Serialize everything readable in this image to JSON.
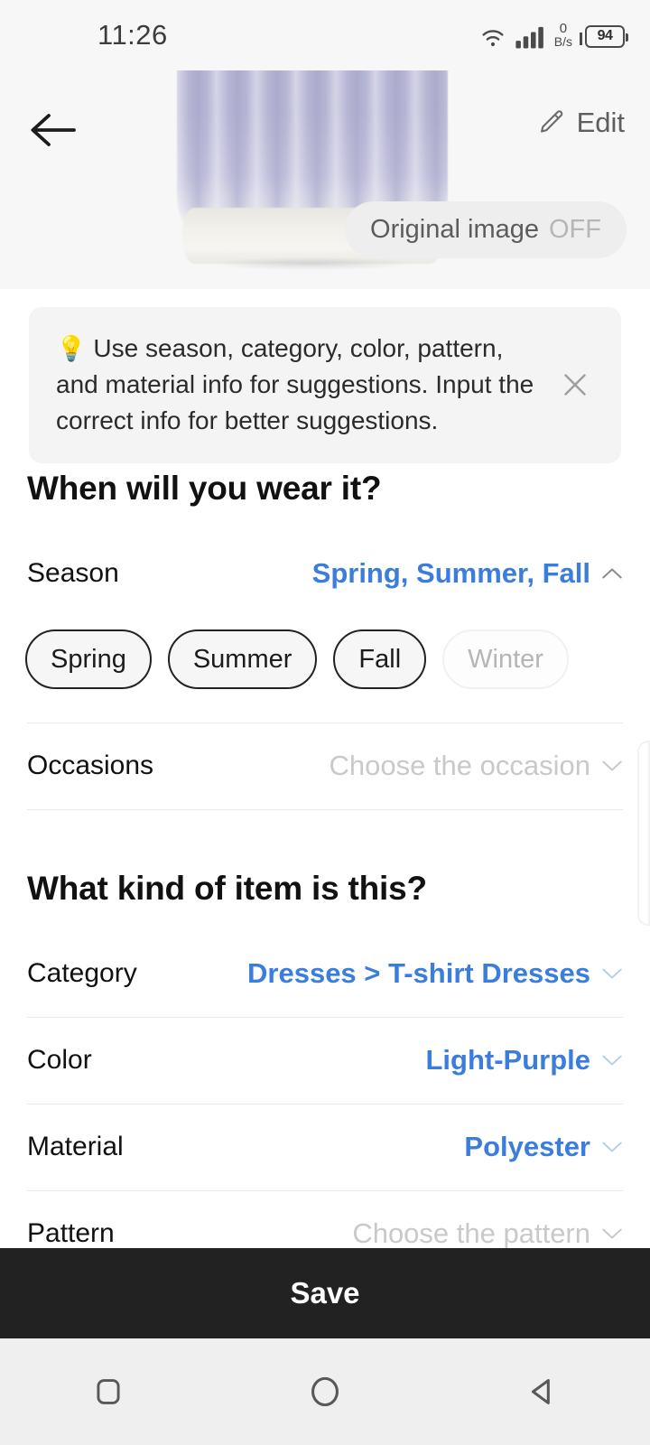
{
  "status_bar": {
    "time": "11:26",
    "net_speed_value": "0",
    "net_speed_unit": "B/s",
    "battery_level": "94",
    "icons": [
      "wifi-icon",
      "cellular-signal-icon",
      "battery-icon"
    ]
  },
  "header": {
    "back_icon": "back-arrow-icon",
    "edit_label": "Edit",
    "edit_icon": "pencil-icon",
    "original_image_label": "Original image",
    "original_image_state": "OFF"
  },
  "tip": {
    "emoji": "💡",
    "text": "Use season, category, color, pattern, and material info for suggestions. Input the correct info for better suggestions.",
    "close_icon": "close-icon"
  },
  "sections": [
    {
      "title": "When will you wear it?",
      "rows": [
        {
          "label": "Season",
          "value": "Spring, Summer, Fall",
          "style": "blue",
          "chevron": "chevron-up-icon"
        },
        {
          "label": "Occasions",
          "value": "Choose the occasion",
          "style": "placeholder",
          "chevron": "chevron-down-icon"
        }
      ]
    },
    {
      "title": "What kind of item is this?",
      "rows": [
        {
          "label": "Category",
          "value": "Dresses > T-shirt Dresses",
          "style": "blue",
          "chevron": "chevron-down-icon"
        },
        {
          "label": "Color",
          "value": "Light-Purple",
          "style": "blue",
          "chevron": "chevron-down-icon"
        },
        {
          "label": "Material",
          "value": "Polyester",
          "style": "blue",
          "chevron": "chevron-down-icon"
        },
        {
          "label": "Pattern",
          "value": "Choose the pattern",
          "style": "placeholder",
          "chevron": "chevron-down-icon"
        }
      ]
    }
  ],
  "season_chips": [
    {
      "label": "Spring",
      "selected": true
    },
    {
      "label": "Summer",
      "selected": true
    },
    {
      "label": "Fall",
      "selected": true
    },
    {
      "label": "Winter",
      "selected": false
    }
  ],
  "save_bar": {
    "label": "Save"
  },
  "nav_bar": {
    "recents_icon": "square-recents-icon",
    "home_icon": "circle-home-icon",
    "back_icon": "triangle-back-icon"
  },
  "colors": {
    "accent_blue": "#3b7ddd",
    "save_bar_bg": "#222222",
    "header_bg": "#f7f7f7",
    "tip_bg": "#f4f4f4",
    "placeholder_gray": "#c9c9c9"
  }
}
